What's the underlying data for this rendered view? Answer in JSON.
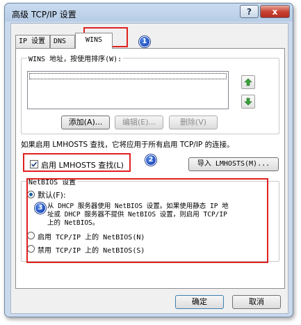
{
  "window": {
    "title": "高级 TCP/IP 设置",
    "help_glyph": "?",
    "close_glyph": "x"
  },
  "tabs": [
    {
      "label": "IP 设置"
    },
    {
      "label": "DNS"
    },
    {
      "label": "WINS"
    }
  ],
  "wins": {
    "group_label": "WINS 地址，按使用排序(W):",
    "add_label": "添加(A)...",
    "edit_label": "编辑(E)...",
    "delete_label": "删除(V)"
  },
  "lmhosts": {
    "info_text": "如果启用 LMHOSTS 查找，它将应用于所有启用 TCP/IP 的连接。",
    "enable_label": "启用 LMHOSTS 查找(L)",
    "enable_checked": true,
    "import_label": "导入 LMHOSTS(M)..."
  },
  "netbios": {
    "group_label": "NetBIOS 设置",
    "default_label": "默认(F):",
    "default_desc_1": "从 DHCP 服务器使用 NetBIOS 设置。如果使用静态 IP 地",
    "default_desc_2": "址或 DHCP 服务器不提供 NetBIOS 设置，则启用 TCP/IP",
    "default_desc_3": "上的 NetBIOS。",
    "enable_label": "启用 TCP/IP 上的 NetBIOS(N)",
    "disable_label": "禁用 TCP/IP 上的 NetBIOS(S)",
    "selected": "default"
  },
  "footer": {
    "ok_label": "确定",
    "cancel_label": "取消"
  },
  "annotations": [
    "1",
    "2",
    "3"
  ],
  "colors": {
    "highlight_red": "#e02020",
    "badge_blue": "#1c48c0",
    "close_red": "#c94536"
  }
}
